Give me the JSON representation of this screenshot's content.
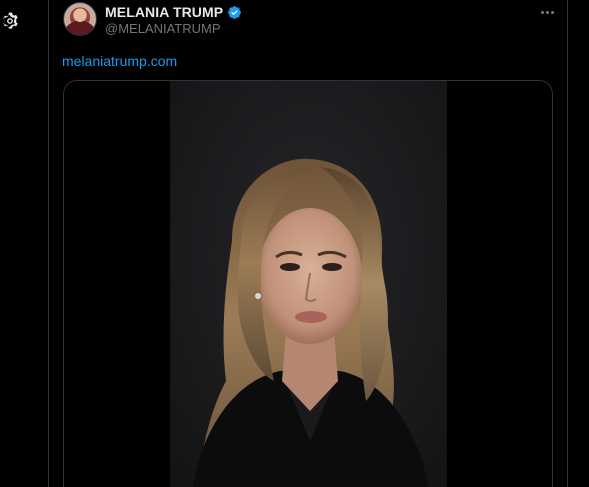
{
  "tweet": {
    "author": {
      "display_name": "MELANIA TRUMP",
      "handle": "@MELANIATRUMP",
      "verified": true,
      "verified_color": "#1d9bf0"
    },
    "text_link": "melaniatrump.com",
    "media": {
      "type": "video",
      "icon": "video-player"
    },
    "more_icon": "more-options-icon"
  },
  "sidebar": {
    "settings_icon": "gear-icon"
  },
  "colors": {
    "background": "#000000",
    "border": "#2f3336",
    "text_primary": "#e7e9ea",
    "text_secondary": "#71767b",
    "link": "#1d9bf0"
  }
}
